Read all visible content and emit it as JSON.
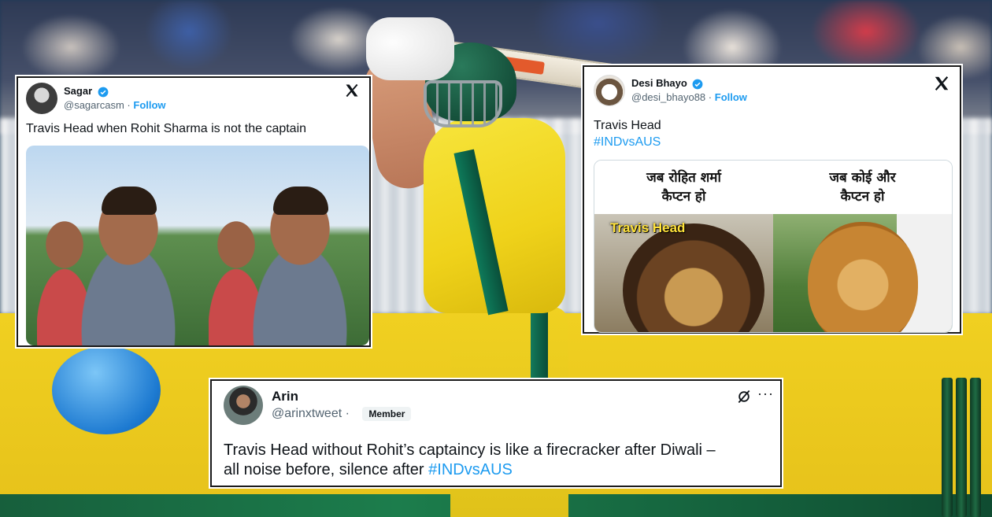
{
  "tweets": {
    "sagar": {
      "name": "Sagar",
      "handle": "@sagarcasm",
      "separator": "·",
      "follow": "Follow",
      "text": "Travis Head when Rohit Sharma is not the captain"
    },
    "desi": {
      "name": "Desi Bhayo",
      "handle": "@desi_bhayo88",
      "separator": "·",
      "follow": "Follow",
      "text_line1": "Travis Head",
      "hashtag": "#INDvsAUS",
      "meme": {
        "left_caption_line1": "जब रोहित शर्मा",
        "left_caption_line2": "कैप्टन हो",
        "right_caption_line1": "जब कोई और",
        "right_caption_line2": "कैप्टन हो",
        "lion_label": "Travis Head"
      }
    },
    "arin": {
      "name": "Arin",
      "handle": "@arinxtweet",
      "separator": "·",
      "badge": "Member",
      "more": "···",
      "text_line1": "Travis Head without Rohit’s captaincy is like a firecracker after Diwali –",
      "text_line2": "all noise before, silence after",
      "hashtag": "#INDvsAUS"
    }
  },
  "colors": {
    "link": "#1d9bf0",
    "verified": "#1d9bf0",
    "text": "#0f1419",
    "muted": "#536471"
  }
}
